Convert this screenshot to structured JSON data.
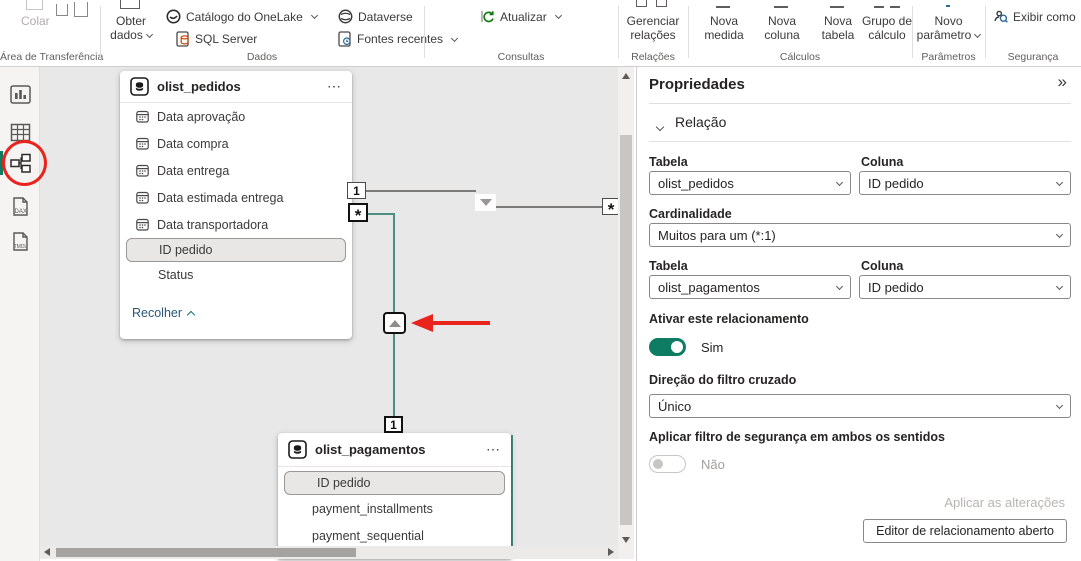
{
  "ribbon": {
    "clipboard": {
      "caption": "Área de Transferência",
      "paste": "Colar"
    },
    "dados": {
      "caption": "Dados",
      "obter1": "Obter",
      "obter2": "dados",
      "onelake": "Catálogo do OneLake",
      "sql": "SQL Server",
      "dataverse": "Dataverse",
      "fontes": "Fontes recentes"
    },
    "consultas": {
      "caption": "Consultas",
      "atualizar": "Atualizar"
    },
    "relacoes": {
      "caption": "Relações",
      "gerenciar1": "Gerenciar",
      "gerenciar2": "relações"
    },
    "calculos": {
      "caption": "Cálculos",
      "medida1": "Nova",
      "medida2": "medida",
      "coluna1": "Nova",
      "coluna2": "coluna",
      "tabela1": "Nova",
      "tabela2": "tabela",
      "grupo1": "Grupo de",
      "grupo2": "cálculo"
    },
    "parametros": {
      "caption": "Parâmetros",
      "novo1": "Novo",
      "novo2": "parâmetro"
    },
    "seguranca": {
      "caption": "Segurança",
      "exibir": "Exibir como"
    }
  },
  "sidebar": {
    "dax": "DAX",
    "tmdl": "TMDL"
  },
  "canvas": {
    "pedidos": {
      "name": "olist_pedidos",
      "menu": "⋯",
      "fields": [
        "Data aprovação",
        "Data compra",
        "Data entrega",
        "Data estimada entrega",
        "Data transportadora",
        "ID pedido",
        "Status"
      ],
      "collapse": "Recolher"
    },
    "pagamentos": {
      "name": "olist_pagamentos",
      "menu": "⋯",
      "fields": [
        "ID pedido",
        "payment_installments",
        "payment_sequential"
      ]
    },
    "markers": {
      "one_left": "1",
      "many_left": "*",
      "many_right": "*",
      "one_bottom": "1"
    }
  },
  "properties": {
    "title": "Propriedades",
    "collapse_icon": "»",
    "section": "Relação",
    "tabela_label": "Tabela",
    "coluna_label": "Coluna",
    "tabela1": "olist_pedidos",
    "coluna1": "ID pedido",
    "cardinalidade_label": "Cardinalidade",
    "cardinalidade": "Muitos para um (*:1)",
    "tabela2": "olist_pagamentos",
    "coluna2": "ID pedido",
    "ativar_label": "Ativar este relacionamento",
    "ativar_value": "Sim",
    "direcao_label": "Direção do filtro cruzado",
    "direcao": "Único",
    "seguranca_label": "Aplicar filtro de segurança em ambos os sentidos",
    "seguranca_value": "Não",
    "aplicar": "Aplicar as alterações",
    "editor": "Editor de relacionamento aberto"
  },
  "colors": {
    "accent_teal": "#0e7b63",
    "relationship_teal": "#4a8d82",
    "annotation_red": "#e8241d"
  }
}
